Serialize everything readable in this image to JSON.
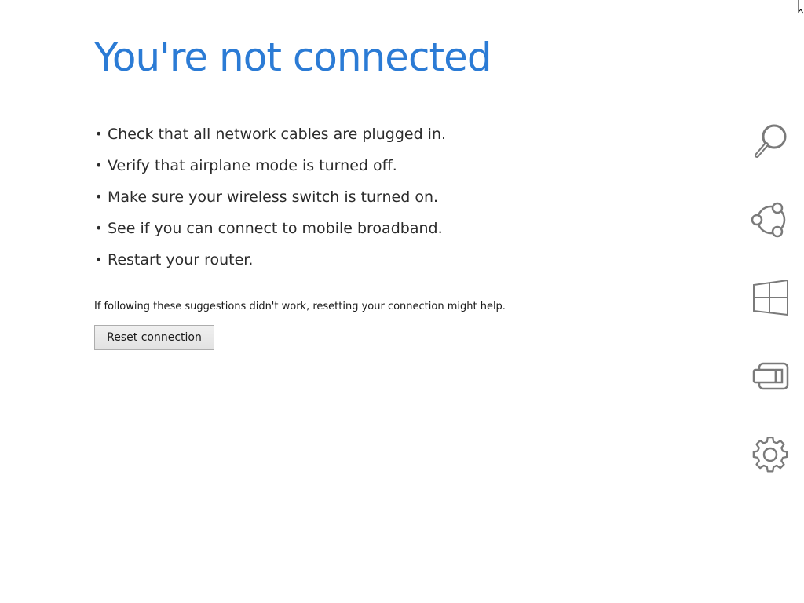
{
  "title": "You're not connected",
  "suggestions": [
    "Check that all network cables are plugged in.",
    "Verify that airplane mode is turned off.",
    "Make sure your wireless switch is turned on.",
    "See if you can connect to mobile broadband.",
    "Restart your router."
  ],
  "bullet": "•",
  "help_text": "If following these suggestions didn't work, resetting your connection might help.",
  "reset_button_label": "Reset connection",
  "charms": [
    "search-icon",
    "share-icon",
    "start-icon",
    "devices-icon",
    "settings-icon"
  ],
  "colors": {
    "title": "#2b7bd5",
    "text": "#2b2b2b",
    "charm_icon": "#7a7a7a"
  }
}
